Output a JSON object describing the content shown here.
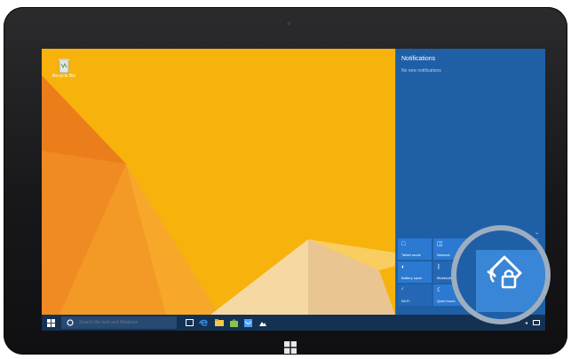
{
  "colors": {
    "wallpaper_yellow": "#f6b40e",
    "wallpaper_orange": "#e98a1f",
    "action_center_bg": "#1f5fa6",
    "quick_action_tile": "#2b79d0",
    "taskbar_bg": "#143152",
    "bezel": "#1c1c1e"
  },
  "desktop": {
    "icons": [
      {
        "name": "recycle-bin-icon",
        "label": "Recycle Bin"
      }
    ]
  },
  "action_center": {
    "title": "Notifications",
    "empty_text": "No new notifications",
    "collapse_label": "Collapse",
    "quick_actions": [
      {
        "icon": "tablet-mode-icon",
        "glyph": "□",
        "label": "Tablet mode"
      },
      {
        "icon": "network-icon",
        "glyph": "◫",
        "label": "Network"
      },
      {
        "icon": "note-icon",
        "glyph": "▭",
        "label": "Note"
      },
      {
        "icon": "settings-icon",
        "glyph": "⚙",
        "label": "All settings"
      },
      {
        "icon": "battery-saver-icon",
        "glyph": "◐",
        "label": "Battery saver"
      },
      {
        "icon": "bluetooth-icon",
        "glyph": "ᛒ",
        "label": "Bluetooth"
      },
      {
        "icon": "vpn-icon",
        "glyph": "⌁",
        "label": "VPN"
      },
      {
        "icon": "brightness-icon",
        "glyph": "☀",
        "label": "Brightness"
      },
      {
        "icon": "wifi-icon",
        "glyph": "◜",
        "label": "Wi-Fi"
      },
      {
        "icon": "quiet-hours-icon",
        "glyph": "☾",
        "label": "Quiet hours"
      },
      {
        "icon": "location-icon",
        "glyph": "◉",
        "label": "Location"
      },
      {
        "icon": "rotation-lock-icon",
        "glyph": "⟳",
        "label": "Rotation lock"
      }
    ],
    "highlighted_action": {
      "icon": "rotation-lock-icon",
      "label": "Rotation lock"
    }
  },
  "taskbar": {
    "search_placeholder": "Search the web and Windows",
    "pinned": [
      {
        "icon": "task-view-icon",
        "color": "#ffffff"
      },
      {
        "icon": "edge-icon",
        "color": "#3b8ee8"
      },
      {
        "icon": "file-explorer-icon",
        "color": "#f2c94c"
      },
      {
        "icon": "store-icon",
        "color": "#8bc34a"
      },
      {
        "icon": "mail-icon",
        "color": "#4aa3ff"
      },
      {
        "icon": "photos-icon",
        "color": "#ffffff"
      }
    ],
    "tray": [
      {
        "icon": "chevron-up-icon",
        "glyph": "^"
      },
      {
        "icon": "volume-icon",
        "glyph": "◂"
      }
    ]
  }
}
